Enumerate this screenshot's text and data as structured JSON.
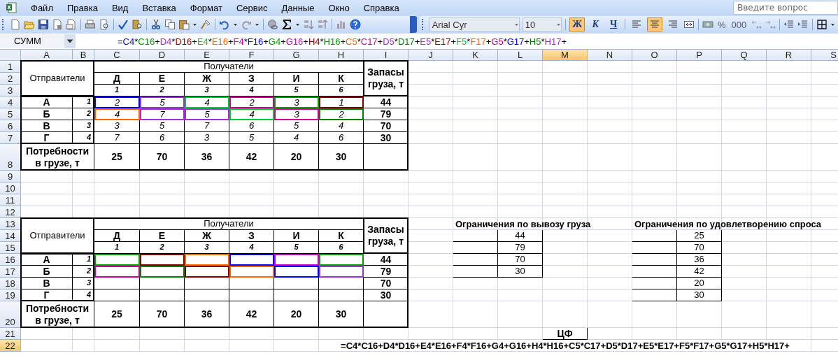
{
  "menu": [
    {
      "label": "Файл"
    },
    {
      "label": "Правка"
    },
    {
      "label": "Вид"
    },
    {
      "label": "Вставка"
    },
    {
      "label": "Формат"
    },
    {
      "label": "Сервис"
    },
    {
      "label": "Данные"
    },
    {
      "label": "Окно"
    },
    {
      "label": "Справка"
    }
  ],
  "search": {
    "placeholder": "Введите вопрос"
  },
  "font_box": {
    "value": "Arial Cyr"
  },
  "size_box": {
    "value": "10"
  },
  "format_toggles": [
    {
      "kind": "bold",
      "label": "Ж",
      "selected": true
    },
    {
      "kind": "italic",
      "label": "К",
      "selected": false
    },
    {
      "kind": "underline",
      "label": "Ч",
      "selected": false
    }
  ],
  "alignment": [
    {
      "kind": "left",
      "selected": false
    },
    {
      "kind": "center",
      "selected": true
    },
    {
      "kind": "right",
      "selected": false
    }
  ],
  "number_buttons": [
    "%",
    "000"
  ],
  "name_box": {
    "value": "СУММ"
  },
  "formula": [
    {
      "text": "="
    },
    {
      "text": "C4",
      "color": "#0000ff"
    },
    {
      "text": "*"
    },
    {
      "text": "C16",
      "color": "#00a000"
    },
    {
      "text": "+"
    },
    {
      "text": "D4",
      "color": "#9933cc"
    },
    {
      "text": "*"
    },
    {
      "text": "D16",
      "color": "#800000"
    },
    {
      "text": "+"
    },
    {
      "text": "E4",
      "color": "#00cc33"
    },
    {
      "text": "*"
    },
    {
      "text": "E16",
      "color": "#ff6600"
    },
    {
      "text": "+"
    },
    {
      "text": "F4",
      "color": "#cc0099"
    },
    {
      "text": "*"
    },
    {
      "text": "F16",
      "color": "#0000ff"
    },
    {
      "text": "+"
    },
    {
      "text": "G4",
      "color": "#00a000"
    },
    {
      "text": "+"
    },
    {
      "text": "G16",
      "color": "#cc00cc"
    },
    {
      "text": "+"
    },
    {
      "text": "H4",
      "color": "#800000"
    },
    {
      "text": "*"
    },
    {
      "text": "H16",
      "color": "#00a000"
    },
    {
      "text": "+"
    },
    {
      "text": "C5",
      "color": "#ff6600"
    },
    {
      "text": "*"
    },
    {
      "text": "C17",
      "color": "#cc0099"
    },
    {
      "text": "+"
    },
    {
      "text": "D5",
      "color": "#9933cc"
    },
    {
      "text": "*"
    },
    {
      "text": "D17",
      "color": "#008000"
    },
    {
      "text": "+"
    },
    {
      "text": "E5",
      "color": "#9933cc"
    },
    {
      "text": "*"
    },
    {
      "text": "E17",
      "color": "#800000"
    },
    {
      "text": "+"
    },
    {
      "text": "F5",
      "color": "#00cc33"
    },
    {
      "text": "*"
    },
    {
      "text": "F17",
      "color": "#ff6600"
    },
    {
      "text": "+"
    },
    {
      "text": "G5",
      "color": "#cc0099"
    },
    {
      "text": "*"
    },
    {
      "text": "G17",
      "color": "#0000ff"
    },
    {
      "text": "+"
    },
    {
      "text": "H5",
      "color": "#008000"
    },
    {
      "text": "*"
    },
    {
      "text": "H17",
      "color": "#9933cc"
    },
    {
      "text": "+"
    }
  ],
  "columns": [
    {
      "label": "A",
      "selected": false
    },
    {
      "label": "B",
      "selected": false
    },
    {
      "label": "C",
      "selected": false
    },
    {
      "label": "D",
      "selected": false
    },
    {
      "label": "E",
      "selected": false
    },
    {
      "label": "F",
      "selected": false
    },
    {
      "label": "G",
      "selected": false
    },
    {
      "label": "H",
      "selected": false
    },
    {
      "label": "I",
      "selected": false
    },
    {
      "label": "J",
      "selected": false
    },
    {
      "label": "K",
      "selected": false
    },
    {
      "label": "L",
      "selected": false
    },
    {
      "label": "M",
      "selected": true
    },
    {
      "label": "N",
      "selected": false
    },
    {
      "label": "O",
      "selected": false
    },
    {
      "label": "P",
      "selected": false
    },
    {
      "label": "Q",
      "selected": false
    },
    {
      "label": "R",
      "selected": false
    },
    {
      "label": "S",
      "selected": false
    }
  ],
  "rows": [
    {
      "label": "1",
      "selected": false
    },
    {
      "label": "2",
      "selected": false
    },
    {
      "label": "3",
      "selected": false
    },
    {
      "label": "4",
      "selected": false
    },
    {
      "label": "5",
      "selected": false
    },
    {
      "label": "6",
      "selected": false
    },
    {
      "label": "7",
      "selected": false
    },
    {
      "label": "8",
      "selected": false
    },
    {
      "label": "9",
      "selected": false
    },
    {
      "label": "10",
      "selected": false
    },
    {
      "label": "11",
      "selected": false
    },
    {
      "label": "12",
      "selected": false
    },
    {
      "label": "13",
      "selected": false
    },
    {
      "label": "14",
      "selected": false
    },
    {
      "label": "15",
      "selected": false
    },
    {
      "label": "16",
      "selected": false
    },
    {
      "label": "17",
      "selected": false
    },
    {
      "label": "18",
      "selected": false
    },
    {
      "label": "19",
      "selected": false
    },
    {
      "label": "20",
      "selected": false
    },
    {
      "label": "21",
      "selected": false
    },
    {
      "label": "22",
      "selected": true
    }
  ],
  "tables": [
    {
      "senders_header": "Отправители",
      "receivers_header": "Получатели",
      "supply_header": "Запасы груза, т",
      "demand_label": "Потребности в грузе, т",
      "receivers": [
        {
          "name": "Д",
          "number": "1"
        },
        {
          "name": "Е",
          "number": "2"
        },
        {
          "name": "Ж",
          "number": "3"
        },
        {
          "name": "З",
          "number": "4"
        },
        {
          "name": "И",
          "number": "5"
        },
        {
          "name": "К",
          "number": "6"
        }
      ],
      "senders": [
        {
          "name": "А",
          "number": "1",
          "supply": "44",
          "cells": [
            {
              "value": "2",
              "color": "#0000ff"
            },
            {
              "value": "5",
              "color": "#9933cc"
            },
            {
              "value": "4",
              "color": "#00cc33"
            },
            {
              "value": "2",
              "color": "#cc0099"
            },
            {
              "value": "3",
              "color": "#00a000"
            },
            {
              "value": "1",
              "color": "#800000"
            }
          ]
        },
        {
          "name": "Б",
          "number": "2",
          "supply": "79",
          "cells": [
            {
              "value": "4",
              "color": "#ff6600"
            },
            {
              "value": "7",
              "color": "#9933cc"
            },
            {
              "value": "5",
              "color": "#9933cc"
            },
            {
              "value": "4",
              "color": "#00cc33"
            },
            {
              "value": "3",
              "color": "#cc0099"
            },
            {
              "value": "2",
              "color": "#008000"
            }
          ]
        },
        {
          "name": "В",
          "number": "3",
          "supply": "70",
          "cells": [
            {
              "value": "3"
            },
            {
              "value": "5"
            },
            {
              "value": "7"
            },
            {
              "value": "6"
            },
            {
              "value": "5"
            },
            {
              "value": "4"
            }
          ]
        },
        {
          "name": "Г",
          "number": "4",
          "supply": "30",
          "cells": [
            {
              "value": "7"
            },
            {
              "value": "6"
            },
            {
              "value": "3"
            },
            {
              "value": "5"
            },
            {
              "value": "4"
            },
            {
              "value": "6"
            }
          ]
        }
      ],
      "demand": [
        "25",
        "70",
        "36",
        "42",
        "20",
        "30"
      ]
    },
    {
      "senders_header": "Отправители",
      "receivers_header": "Получатели",
      "supply_header": "Запасы груза, т",
      "demand_label": "Потребности в грузе, т",
      "receivers": [
        {
          "name": "Д",
          "number": "1"
        },
        {
          "name": "Е",
          "number": "2"
        },
        {
          "name": "Ж",
          "number": "3"
        },
        {
          "name": "З",
          "number": "4"
        },
        {
          "name": "И",
          "number": "5"
        },
        {
          "name": "К",
          "number": "6"
        }
      ],
      "senders": [
        {
          "name": "А",
          "number": "1",
          "supply": "44",
          "cells": [
            {
              "color": "#00a000"
            },
            {
              "color": "#800000"
            },
            {
              "color": "#ff6600"
            },
            {
              "color": "#0000ff"
            },
            {
              "color": "#cc00cc"
            },
            {
              "color": "#00a000"
            }
          ]
        },
        {
          "name": "Б",
          "number": "2",
          "supply": "79",
          "cells": [
            {
              "color": "#cc0099"
            },
            {
              "color": "#008000"
            },
            {
              "color": "#800000"
            },
            {
              "color": "#ff6600"
            },
            {
              "color": "#0000ff"
            },
            {
              "color": "#9933cc"
            }
          ]
        },
        {
          "name": "В",
          "number": "3",
          "supply": "70"
        },
        {
          "name": "Г",
          "number": "4",
          "supply": "30"
        }
      ],
      "demand": [
        "25",
        "70",
        "36",
        "42",
        "20",
        "30"
      ]
    }
  ],
  "supply_constraints": {
    "title": "Ограничения по вывозу груза",
    "values": [
      "44",
      "79",
      "70",
      "30"
    ]
  },
  "demand_constraints": {
    "title": "Ограничения по удовлетворению спроса",
    "values": [
      "25",
      "70",
      "36",
      "42",
      "20",
      "30"
    ]
  },
  "objective": {
    "label": "ЦФ",
    "formula": "=C4*C16+D4*D16+E4*E16+F4*F16+G4+G16+H4*H16+C5*C17+D5*D17+E5*E17+F5*F17+G5*G17+H5*H17+"
  }
}
